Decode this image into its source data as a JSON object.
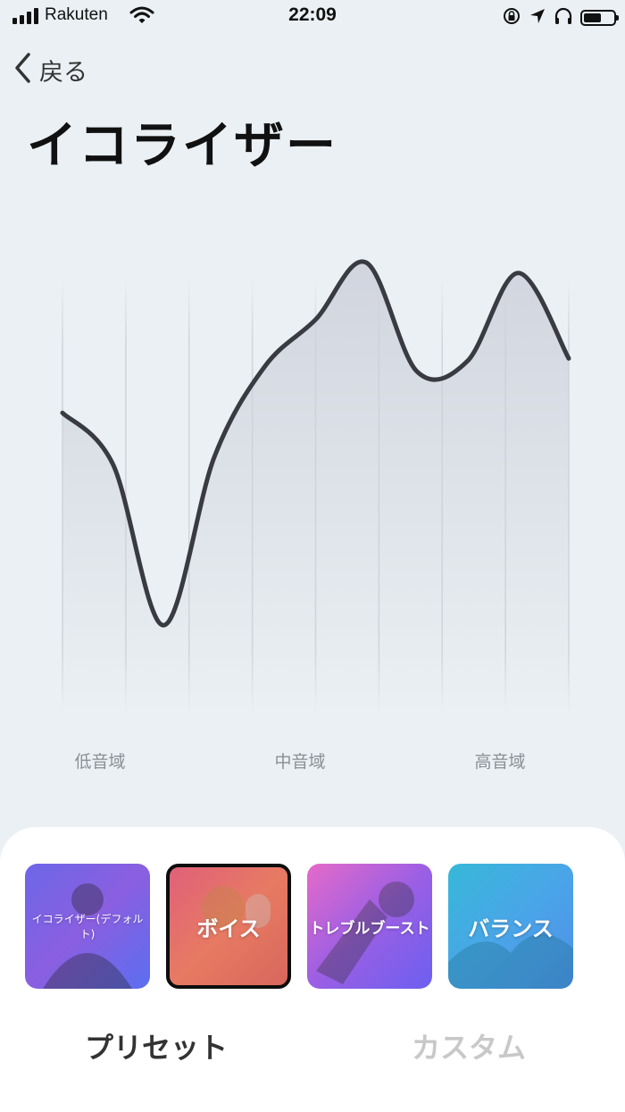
{
  "status_bar": {
    "carrier": "Rakuten",
    "time": "22:09",
    "battery_level": 0.6
  },
  "nav": {
    "back_label": "戻る"
  },
  "page": {
    "title": "イコライザー"
  },
  "equalizer": {
    "bands": [
      "低音域",
      "中音域",
      "高音域"
    ],
    "curve": [
      0.32,
      0.12,
      -0.5,
      0.15,
      0.5,
      0.68,
      0.9,
      0.48,
      0.52,
      0.86,
      0.53
    ],
    "line_color": "#3a3b42",
    "fill_color": "#cdd0db"
  },
  "presets": [
    {
      "label": "イコライザー(デフォルト)",
      "selected": false,
      "colors": [
        "#6d67e8",
        "#8a5fe0",
        "#5b6ef0"
      ]
    },
    {
      "label": "ボイス",
      "selected": true,
      "colors": [
        "#e0607a",
        "#e77a63",
        "#d8675c"
      ]
    },
    {
      "label": "トレブルブースト",
      "selected": false,
      "colors": [
        "#e66ac9",
        "#9b5fe4",
        "#6c5ff0"
      ]
    },
    {
      "label": "バランス",
      "selected": false,
      "colors": [
        "#36b8d8",
        "#4aa5e8",
        "#4f8fe8"
      ]
    }
  ],
  "tabs": [
    {
      "label": "プリセット",
      "active": true
    },
    {
      "label": "カスタム",
      "active": false
    }
  ],
  "colors": {
    "active_tab": "#333333",
    "inactive_tab": "#c8c8c8",
    "background": "#eaf0f3"
  }
}
